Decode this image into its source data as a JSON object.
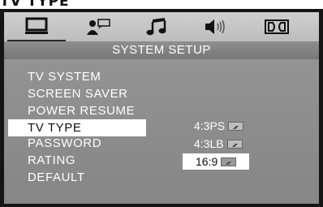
{
  "caption": "TV TYPE",
  "tabs": [
    {
      "name": "general-setup",
      "icon": "monitor-icon"
    },
    {
      "name": "speaker-setup",
      "icon": "person-speech-icon"
    },
    {
      "name": "audio-setup",
      "icon": "music-note-icon"
    },
    {
      "name": "speaker-volume",
      "icon": "speaker-sound-icon"
    },
    {
      "name": "dolby-setup",
      "icon": "dolby-icon"
    }
  ],
  "header": {
    "title": "SYSTEM SETUP"
  },
  "menu": {
    "items": [
      {
        "label": "TV SYSTEM"
      },
      {
        "label": "SCREEN SAVER"
      },
      {
        "label": "POWER RESUME"
      },
      {
        "label": "TV TYPE"
      },
      {
        "label": "PASSWORD"
      },
      {
        "label": "RATING"
      },
      {
        "label": "DEFAULT"
      }
    ],
    "highlighted": "TV TYPE"
  },
  "options": {
    "items": [
      {
        "label": "4:3PS"
      },
      {
        "label": "4:3LB"
      },
      {
        "label": "16:9"
      }
    ],
    "selected": "16:9"
  },
  "colors": {
    "menu_bg": "#8b8b8b",
    "tabbar_bg": "#c8c8c8",
    "highlight": "#ffffff"
  }
}
